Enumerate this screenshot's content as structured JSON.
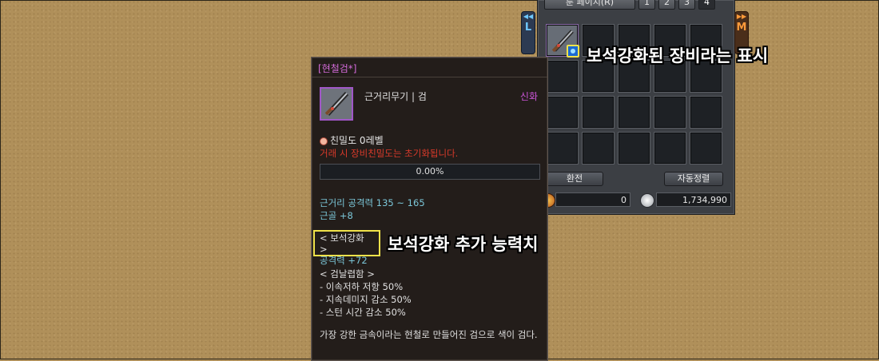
{
  "inventory": {
    "page_button": "룬 페이지(R)",
    "tabs": [
      "1",
      "2",
      "3",
      "4"
    ],
    "active_tab": "4",
    "left_tab_label": "L",
    "right_tab_label": "M",
    "exchange_button": "환전",
    "autosort_button": "자동정렬",
    "gold_value": "0",
    "silver_value": "1,734,990"
  },
  "tooltip": {
    "title": "[현철검*]",
    "item_type": "근거리무기 | 검",
    "grade": "신화",
    "intimacy": "친밀도 0레벨",
    "warning": "거래 시 장비친밀도는 초기화됩니다.",
    "progress_text": "0.00%",
    "progress_value": 0,
    "stat_attack": "근거리 공격력 135 ~ 165",
    "stat_str": "근골 +8",
    "gem_header": "< 보석강화 >",
    "gem_value": "공격력 +72",
    "enchant_header": "< 검날렵함 >",
    "enchant_items": [
      "- 이속저하 저항 50%",
      "- 지속데미지 감소 50%",
      "- 스턴 시간 감소 50%"
    ],
    "description": "가장 강한 금속이라는 현철로 만들어진 검으로 색이 검다."
  },
  "annotations": {
    "gem_equipped_note": "보석강화된 장비라는 표시",
    "gem_stat_note": "보석강화 추가 능력치"
  },
  "colors": {
    "title_purple": "#d36bd9",
    "warning_red": "#d93a2a",
    "stat_cyan": "#7bc6d8",
    "highlight_yellow": "#f0e24a",
    "background_sand": "#b0905a"
  }
}
